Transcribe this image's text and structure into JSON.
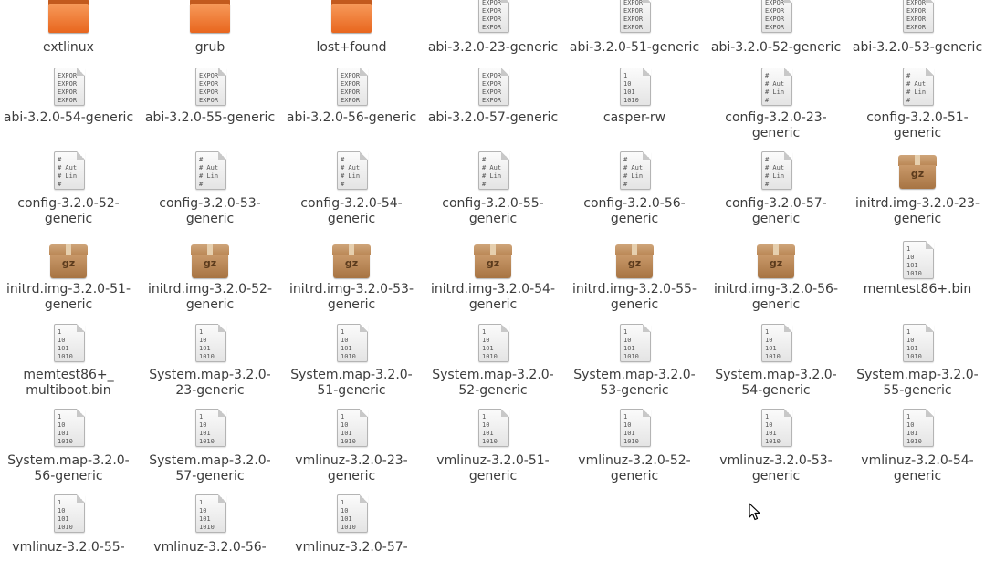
{
  "items": [
    {
      "label": "extlinux",
      "icon": "folder-icon"
    },
    {
      "label": "grub",
      "icon": "folder-icon"
    },
    {
      "label": "lost+found",
      "icon": "folder-icon"
    },
    {
      "label": "abi-3.2.0-23-generic",
      "icon": "text-file-icon",
      "preview": "EXPOR\nEXPOR\nEXPOR\nEXPOR"
    },
    {
      "label": "abi-3.2.0-51-generic",
      "icon": "text-file-icon",
      "preview": "EXPOR\nEXPOR\nEXPOR\nEXPOR"
    },
    {
      "label": "abi-3.2.0-52-generic",
      "icon": "text-file-icon",
      "preview": "EXPOR\nEXPOR\nEXPOR\nEXPOR"
    },
    {
      "label": "abi-3.2.0-53-generic",
      "icon": "text-file-icon",
      "preview": "EXPOR\nEXPOR\nEXPOR\nEXPOR"
    },
    {
      "label": "abi-3.2.0-54-generic",
      "icon": "text-file-icon",
      "preview": "EXPOR\nEXPOR\nEXPOR\nEXPOR"
    },
    {
      "label": "abi-3.2.0-55-generic",
      "icon": "text-file-icon",
      "preview": "EXPOR\nEXPOR\nEXPOR\nEXPOR"
    },
    {
      "label": "abi-3.2.0-56-generic",
      "icon": "text-file-icon",
      "preview": "EXPOR\nEXPOR\nEXPOR\nEXPOR"
    },
    {
      "label": "abi-3.2.0-57-generic",
      "icon": "text-file-icon",
      "preview": "EXPOR\nEXPOR\nEXPOR\nEXPOR"
    },
    {
      "label": "casper-rw",
      "icon": "binary-file-icon",
      "preview": "1\n10\n101\n1010"
    },
    {
      "label": "config-3.2.0-23-\ngeneric",
      "icon": "text-file-icon",
      "preview": "#\n# Aut\n# Lin\n#"
    },
    {
      "label": "config-3.2.0-51-\ngeneric",
      "icon": "text-file-icon",
      "preview": "#\n# Aut\n# Lin\n#"
    },
    {
      "label": "config-3.2.0-52-\ngeneric",
      "icon": "text-file-icon",
      "preview": "#\n# Aut\n# Lin\n#"
    },
    {
      "label": "config-3.2.0-53-\ngeneric",
      "icon": "text-file-icon",
      "preview": "#\n# Aut\n# Lin\n#"
    },
    {
      "label": "config-3.2.0-54-\ngeneric",
      "icon": "text-file-icon",
      "preview": "#\n# Aut\n# Lin\n#"
    },
    {
      "label": "config-3.2.0-55-\ngeneric",
      "icon": "text-file-icon",
      "preview": "#\n# Aut\n# Lin\n#"
    },
    {
      "label": "config-3.2.0-56-\ngeneric",
      "icon": "text-file-icon",
      "preview": "#\n# Aut\n# Lin\n#"
    },
    {
      "label": "config-3.2.0-57-\ngeneric",
      "icon": "text-file-icon",
      "preview": "#\n# Aut\n# Lin\n#"
    },
    {
      "label": "initrd.img-3.2.0-23-\ngeneric",
      "icon": "package-icon",
      "preview": "gz"
    },
    {
      "label": "initrd.img-3.2.0-51-\ngeneric",
      "icon": "package-icon",
      "preview": "gz"
    },
    {
      "label": "initrd.img-3.2.0-52-\ngeneric",
      "icon": "package-icon",
      "preview": "gz"
    },
    {
      "label": "initrd.img-3.2.0-53-\ngeneric",
      "icon": "package-icon",
      "preview": "gz"
    },
    {
      "label": "initrd.img-3.2.0-54-\ngeneric",
      "icon": "package-icon",
      "preview": "gz"
    },
    {
      "label": "initrd.img-3.2.0-55-\ngeneric",
      "icon": "package-icon",
      "preview": "gz"
    },
    {
      "label": "initrd.img-3.2.0-56-\ngeneric",
      "icon": "package-icon",
      "preview": "gz"
    },
    {
      "label": "memtest86+.bin",
      "icon": "binary-file-icon",
      "preview": "1\n10\n101\n1010"
    },
    {
      "label": "memtest86+_\nmultiboot.bin",
      "icon": "binary-file-icon",
      "preview": "1\n10\n101\n1010"
    },
    {
      "label": "System.map-3.2.0-\n23-generic",
      "icon": "binary-file-icon",
      "preview": "1\n10\n101\n1010"
    },
    {
      "label": "System.map-3.2.0-\n51-generic",
      "icon": "binary-file-icon",
      "preview": "1\n10\n101\n1010"
    },
    {
      "label": "System.map-3.2.0-\n52-generic",
      "icon": "binary-file-icon",
      "preview": "1\n10\n101\n1010"
    },
    {
      "label": "System.map-3.2.0-\n53-generic",
      "icon": "binary-file-icon",
      "preview": "1\n10\n101\n1010"
    },
    {
      "label": "System.map-3.2.0-\n54-generic",
      "icon": "binary-file-icon",
      "preview": "1\n10\n101\n1010"
    },
    {
      "label": "System.map-3.2.0-\n55-generic",
      "icon": "binary-file-icon",
      "preview": "1\n10\n101\n1010"
    },
    {
      "label": "System.map-3.2.0-\n56-generic",
      "icon": "binary-file-icon",
      "preview": "1\n10\n101\n1010"
    },
    {
      "label": "System.map-3.2.0-\n57-generic",
      "icon": "binary-file-icon",
      "preview": "1\n10\n101\n1010"
    },
    {
      "label": "vmlinuz-3.2.0-23-\ngeneric",
      "icon": "binary-file-icon",
      "preview": "1\n10\n101\n1010"
    },
    {
      "label": "vmlinuz-3.2.0-51-\ngeneric",
      "icon": "binary-file-icon",
      "preview": "1\n10\n101\n1010"
    },
    {
      "label": "vmlinuz-3.2.0-52-\ngeneric",
      "icon": "binary-file-icon",
      "preview": "1\n10\n101\n1010"
    },
    {
      "label": "vmlinuz-3.2.0-53-\ngeneric",
      "icon": "binary-file-icon",
      "preview": "1\n10\n101\n1010"
    },
    {
      "label": "vmlinuz-3.2.0-54-\ngeneric",
      "icon": "binary-file-icon",
      "preview": "1\n10\n101\n1010"
    },
    {
      "label": "vmlinuz-3.2.0-55-",
      "icon": "binary-file-icon",
      "preview": "1\n10\n101\n1010"
    },
    {
      "label": "vmlinuz-3.2.0-56-",
      "icon": "binary-file-icon",
      "preview": "1\n10\n101\n1010"
    },
    {
      "label": "vmlinuz-3.2.0-57-",
      "icon": "binary-file-icon",
      "preview": "1\n10\n101\n1010"
    }
  ],
  "cursor": {
    "icon": "mouse-pointer-icon"
  }
}
